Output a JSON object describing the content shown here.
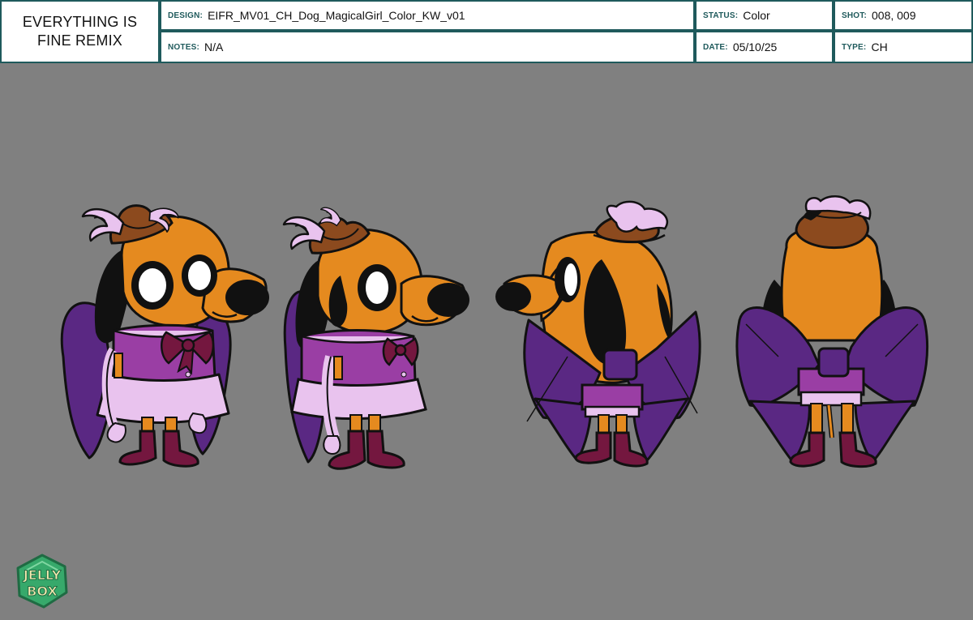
{
  "header": {
    "title_line1": "EVERYTHING IS",
    "title_line2": "FINE REMIX",
    "design_label": "DESIGN:",
    "design_value": "EIFR_MV01_CH_Dog_MagicalGirl_Color_KW_v01",
    "notes_label": "NOTES:",
    "notes_value": "N/A",
    "status_label": "STATUS:",
    "status_value": "Color",
    "date_label": "DATE:",
    "date_value": "05/10/25",
    "shot_label": "SHOT:",
    "shot_value": "008, 009",
    "type_label": "TYPE:",
    "type_value": "CH"
  },
  "logo": {
    "text_top": "JELLY",
    "text_bottom": "BOX"
  },
  "colors": {
    "header_border": "#1f5a5c",
    "background": "#808080",
    "dog_fur": "#e58a1f",
    "dress_purple": "#9a3ea4",
    "bow_purple": "#5a2883",
    "lavender": "#e9c3ee",
    "hat_brown": "#8c4a1e",
    "boot_maroon": "#74173f",
    "logo_green": "#37a96b"
  },
  "views": [
    "front",
    "three-quarter",
    "side",
    "back"
  ]
}
